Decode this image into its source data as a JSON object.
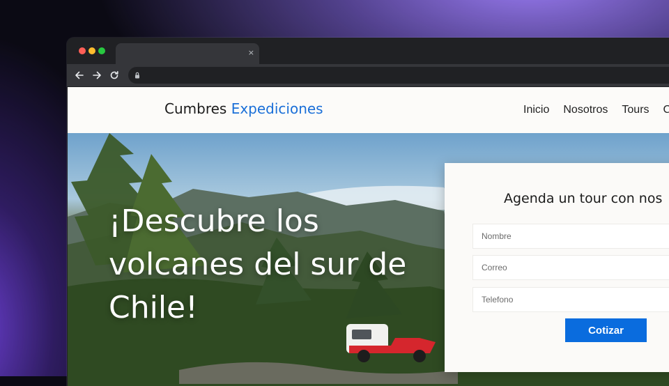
{
  "browser": {
    "tab_close_glyph": "×"
  },
  "site": {
    "logo_primary": "Cumbres",
    "logo_accent": "Expediciones",
    "accent_color": "#1a6fd8",
    "nav": [
      "Inicio",
      "Nosotros",
      "Tours",
      "C"
    ]
  },
  "hero": {
    "headline": "¡Descubre los volcanes del sur de Chile!"
  },
  "booking_form": {
    "title": "Agenda un tour con nos",
    "name_placeholder": "Nombre",
    "email_placeholder": "Correo",
    "phone_placeholder": "Telefono",
    "submit_label": "Cotizar",
    "button_color": "#0a6cde"
  }
}
